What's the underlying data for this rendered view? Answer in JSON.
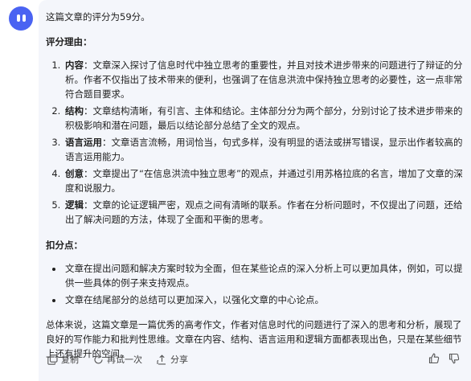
{
  "message": {
    "intro": "这篇文章的评分为59分。",
    "reasons_heading": "评分理由：",
    "reasons": [
      {
        "term": "内容",
        "text": "：文章深入探讨了信息时代中独立思考的重要性，并且对技术进步带来的问题进行了辩证的分析。作者不仅指出了技术带来的便利，也强调了在信息洪流中保持独立思考的必要性，这一点非常符合题目要求。"
      },
      {
        "term": "结构",
        "text": "：文章结构清晰，有引言、主体和结论。主体部分分为两个部分，分别讨论了技术进步带来的积极影响和潜在问题，最后以结论部分总结了全文的观点。"
      },
      {
        "term": "语言运用",
        "text": "：文章语言流畅，用词恰当，句式多样，没有明显的语法或拼写错误，显示出作者较高的语言运用能力。"
      },
      {
        "term": "创意",
        "text": "：文章提出了“在信息洪流中独立思考”的观点，并通过引用苏格拉底的名言，增加了文章的深度和说服力。"
      },
      {
        "term": "逻辑",
        "text": "：文章的论证逻辑严密，观点之间有清晰的联系。作者在分析问题时，不仅提出了问题，还给出了解决问题的方法，体现了全面和平衡的思考。"
      }
    ],
    "deductions_heading": "扣分点：",
    "deductions": [
      "文章在提出问题和解决方案时较为全面，但在某些论点的深入分析上可以更加具体，例如，可以提供一些具体的例子来支持观点。",
      "文章在结尾部分的总结可以更加深入，以强化文章的中心论点。"
    ],
    "summary": "总体来说，这篇文章是一篇优秀的高考作文，作者对信息时代的问题进行了深入的思考和分析，展现了良好的写作能力和批判性思维。文章在内容、结构、语言运用和逻辑方面都表现出色，只是在某些细节上还有提升的空间。"
  },
  "actions": {
    "copy_label": "复制",
    "retry_label": "再试一次",
    "share_label": "分享"
  },
  "colors": {
    "avatar": "#4a63f2",
    "bubble_bg": "#f4f6fb",
    "text": "#1f1f1f"
  }
}
